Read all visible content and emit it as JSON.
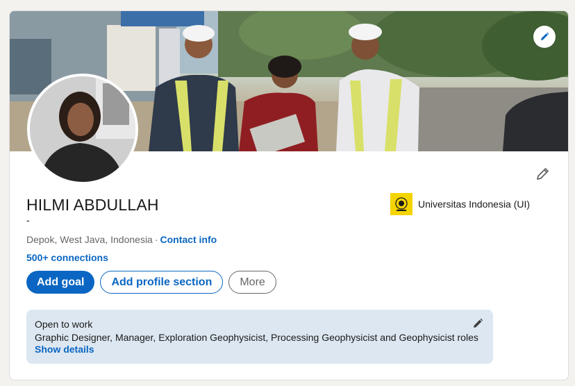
{
  "profile": {
    "name": "HILMI ABDULLAH",
    "headline": "-",
    "location": "Depok, West Java, Indonesia",
    "separator": "·",
    "contact_info": "Contact info",
    "connections": "500+ connections"
  },
  "education": {
    "school_name": "Universitas Indonesia (UI)"
  },
  "actions": {
    "add_goal": "Add goal",
    "add_profile_section": "Add profile section",
    "more": "More"
  },
  "open_to_work": {
    "title": "Open to work",
    "roles": "Graphic Designer, Manager, Exploration Geophysicist, Processing Geophysicist and Geophysicist roles",
    "show_details": "Show details"
  },
  "icons": {
    "banner_edit": "pencil-icon",
    "profile_edit": "pencil-icon",
    "open_to_work_edit": "pencil-icon",
    "school_logo": "university-logo"
  },
  "colors": {
    "accent": "#0a66c2",
    "school_logo_bg": "#f4d400",
    "open_to_work_bg": "#dde7f1"
  }
}
